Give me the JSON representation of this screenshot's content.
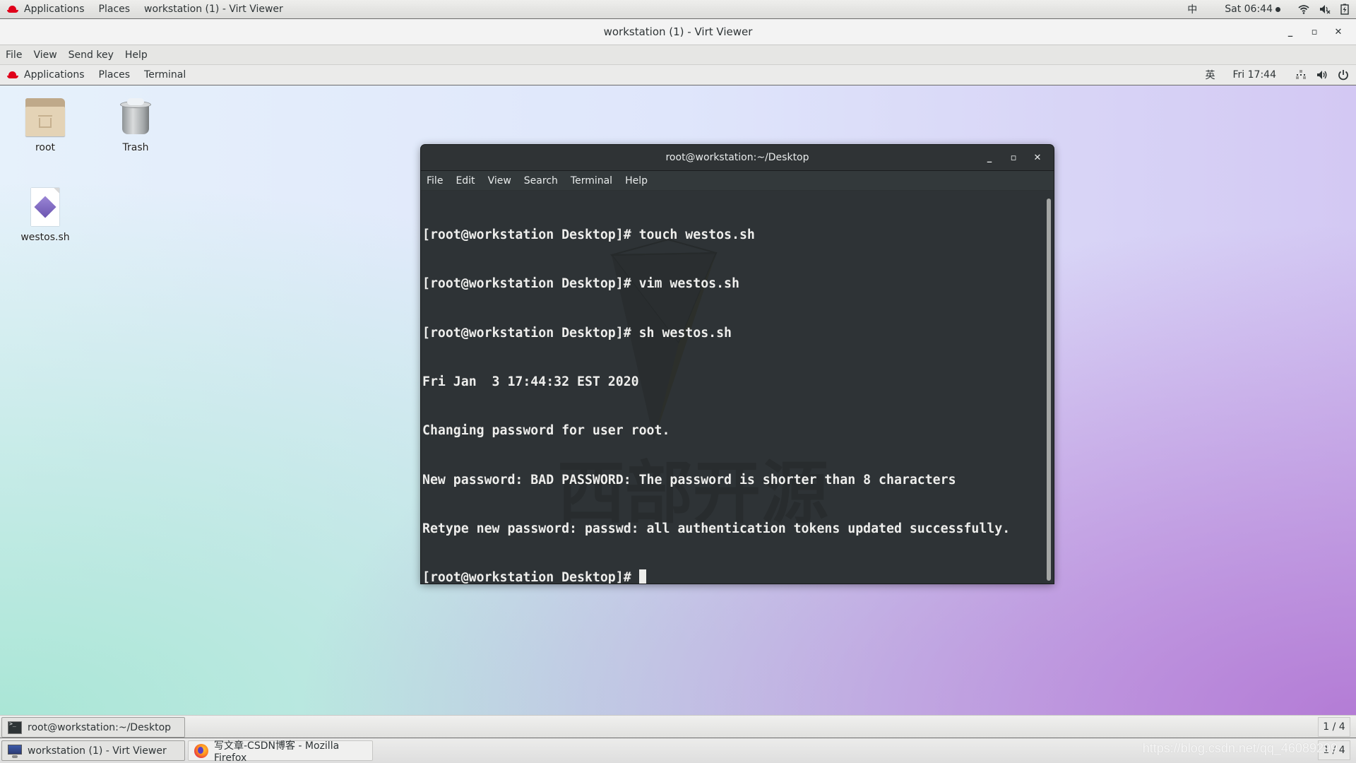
{
  "host_topbar": {
    "applications_label": "Applications",
    "places_label": "Places",
    "window_label": "workstation (1) - Virt Viewer",
    "input_method": "中",
    "clock": "Sat 06:44",
    "icons": [
      "redhat-logo-icon",
      "wifi-icon",
      "volume-muted-icon",
      "battery-charging-icon"
    ]
  },
  "virt_viewer": {
    "title": "workstation (1) - Virt Viewer",
    "controls": {
      "minimize": "_",
      "maximize": "▫",
      "close": "✕"
    },
    "menus": [
      "File",
      "View",
      "Send key",
      "Help"
    ]
  },
  "guest_topbar": {
    "applications_label": "Applications",
    "places_label": "Places",
    "app_label": "Terminal",
    "input_method": "英",
    "clock": "Fri 17:44",
    "icons": [
      "redhat-logo-icon",
      "network-wired-icon",
      "volume-icon",
      "power-icon"
    ]
  },
  "desktop_icons": [
    {
      "label": "root",
      "icon": "home-folder-icon"
    },
    {
      "label": "Trash",
      "icon": "trash-icon"
    },
    {
      "label": "westos.sh",
      "icon": "script-file-icon"
    }
  ],
  "terminal": {
    "title": "root@workstation:~/Desktop",
    "controls": {
      "minimize": "_",
      "maximize": "▫",
      "close": "✕"
    },
    "menus": [
      "File",
      "Edit",
      "View",
      "Search",
      "Terminal",
      "Help"
    ],
    "lines": [
      "[root@workstation Desktop]# touch westos.sh",
      "[root@workstation Desktop]# vim westos.sh",
      "[root@workstation Desktop]# sh westos.sh",
      "Fri Jan  3 17:44:32 EST 2020",
      "Changing password for user root.",
      "New password: BAD PASSWORD: The password is shorter than 8 characters",
      "Retype new password: passwd: all authentication tokens updated successfully."
    ],
    "prompt": "[root@workstation Desktop]# ",
    "watermark_text": "西部开源"
  },
  "guest_taskbar": {
    "tasks": [
      {
        "label": "root@workstation:~/Desktop",
        "icon": "terminal-icon"
      }
    ],
    "pager": "1 / 4"
  },
  "host_taskbar": {
    "tasks": [
      {
        "label": "workstation (1) - Virt Viewer",
        "icon": "monitor-icon"
      },
      {
        "label": "写文章-CSDN博客 - Mozilla Firefox",
        "icon": "firefox-icon"
      }
    ],
    "pager": "1 / 4",
    "overlay_watermark": "https://blog.csdn.net/qq_46089299"
  }
}
